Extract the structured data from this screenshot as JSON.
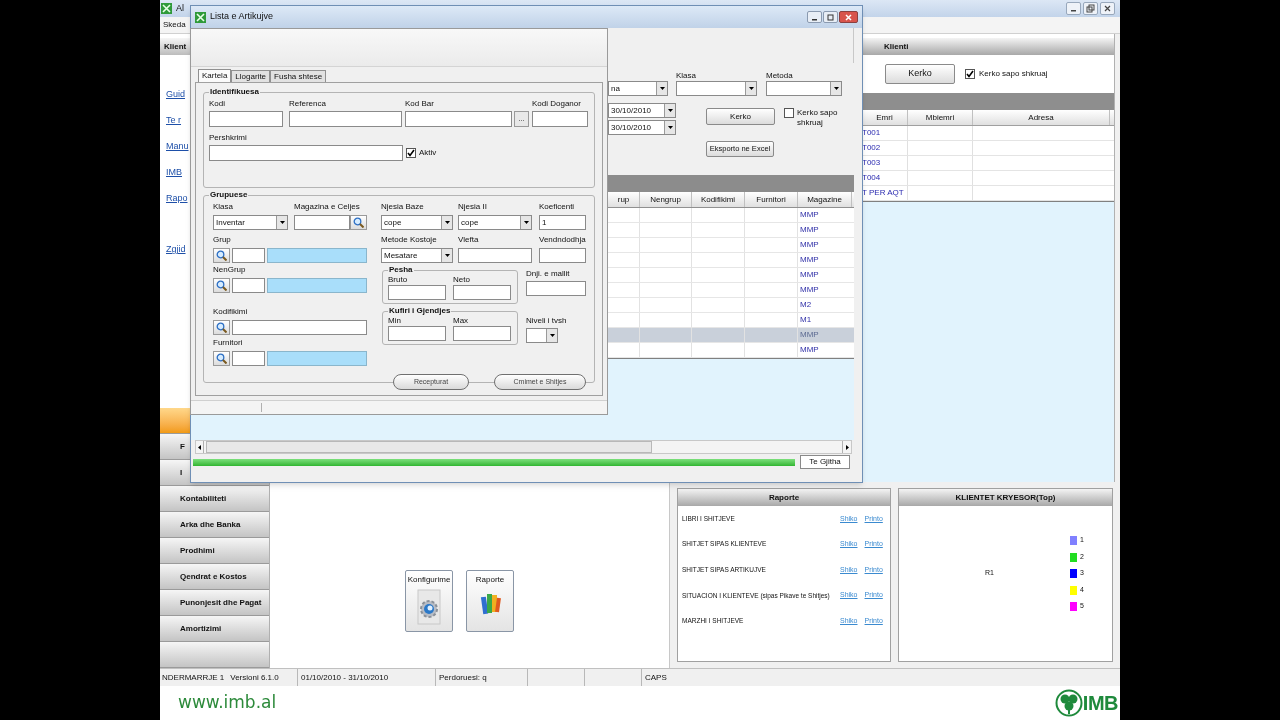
{
  "app": {
    "title": "Al",
    "menu": [
      "Skeda"
    ]
  },
  "sidebar": {
    "header": "Klient",
    "links": [
      "Guid",
      "Te r",
      "Manu",
      "IMB",
      "Rapo"
    ],
    "action": "Zgjid",
    "nav": [
      {
        "selected": true
      },
      {
        "label": "F",
        "selected": false
      },
      {
        "label": "I",
        "selected": false
      },
      {
        "label": "Kontabiliteti",
        "selected": false
      },
      {
        "label": "Arka dhe Banka",
        "selected": false
      },
      {
        "label": "Prodhimi",
        "selected": false
      },
      {
        "label": "Qendrat e Kostos",
        "selected": false
      },
      {
        "label": "Punonjesit dhe Pagat",
        "selected": false
      },
      {
        "label": "Amortizimi",
        "selected": false
      },
      {
        "selected": false
      }
    ]
  },
  "tiles": [
    {
      "label": "Konfigurime",
      "kind": "gear"
    },
    {
      "label": "Raporte",
      "kind": "books"
    }
  ],
  "klienti": {
    "title": "Klienti",
    "search_button": "Kerko",
    "live_search": {
      "label": "Kerko sapo shkruaj",
      "checked": true
    },
    "columns": [
      "Emri",
      "Mbiemri",
      "Adresa"
    ],
    "rows": [
      "T001",
      "T002",
      "T003",
      "T004",
      "T PER AQT"
    ]
  },
  "reports": {
    "title": "Raporte",
    "items": [
      {
        "name": "LIBRI I SHITJEVE",
        "view": "Shiko",
        "print": "Printo"
      },
      {
        "name": "SHITJET SIPAS KLIENTEVE",
        "view": "Shiko",
        "print": "Printo"
      },
      {
        "name": "SHITJET SIPAS ARTIKUJVE",
        "view": "Shiko",
        "print": "Printo"
      },
      {
        "name": "SITUACION I KLIENTEVE (sipas Pikave te Shitjes)",
        "view": "Shiko",
        "print": "Printo"
      },
      {
        "name": "MARZHI I SHITJEVE",
        "view": "Shiko",
        "print": "Printo"
      }
    ]
  },
  "top_clients": {
    "title": "KLIENTET KRYESOR(Top)",
    "series_label": "R1",
    "legend": [
      {
        "label": "1",
        "color": "#8080ff"
      },
      {
        "label": "2",
        "color": "#22dd22"
      },
      {
        "label": "3",
        "color": "#0000ff"
      },
      {
        "label": "4",
        "color": "#ffff00"
      },
      {
        "label": "5",
        "color": "#ff00ff"
      }
    ]
  },
  "status_bar": {
    "company": "NDERMARRJE 1",
    "version": "Versioni 6.1.0",
    "period": "01/10/2010 - 31/10/2010",
    "user": "Perdoruesi: q",
    "caps": "CAPS"
  },
  "footer": {
    "url": "www.imb.al",
    "brand": "IMB"
  },
  "list_window": {
    "title": "Lista e Artikujve",
    "combo_value": "na",
    "filter_labels": [
      "Klasa",
      "Metoda"
    ],
    "dates": [
      "30/10/2010",
      "30/10/2010"
    ],
    "search_button": "Kerko",
    "live_search": {
      "label": "Kerko sapo shkruaj",
      "checked": false
    },
    "export_button": "Eksporto ne Excel",
    "columns": [
      "rup",
      "Nengrup",
      "Kodifikimi",
      "Furnitori",
      "Magazine"
    ],
    "rows": [
      {
        "magazine": "MMP",
        "selected": false
      },
      {
        "magazine": "MMP",
        "selected": false
      },
      {
        "magazine": "MMP",
        "selected": false
      },
      {
        "magazine": "MMP",
        "selected": false
      },
      {
        "magazine": "MMP",
        "selected": false
      },
      {
        "magazine": "MMP",
        "selected": false
      },
      {
        "magazine": "M2",
        "selected": false
      },
      {
        "magazine": "M1",
        "selected": false
      },
      {
        "magazine": "MMP",
        "selected": true
      },
      {
        "magazine": "MMP",
        "selected": false
      }
    ],
    "all_button": "Te Gjitha",
    "progress": {
      "level": 1
    }
  },
  "item_form": {
    "tabs": [
      {
        "label": "Kartela",
        "selected": true
      },
      {
        "label": "Llogarite",
        "selected": false
      },
      {
        "label": "Fusha shtese",
        "selected": false
      }
    ],
    "identification": {
      "title": "Identifikuesa",
      "code": "Kodi",
      "reference": "Referenca",
      "barcode": "Kod Bar",
      "browse_button": "...",
      "customs_code": "Kodi Doganor",
      "description": "Pershkrimi",
      "active": {
        "label": "Aktiv",
        "checked": true
      }
    },
    "grouping": {
      "title": "Grupuese",
      "klasa": {
        "label": "Klasa",
        "value": "Inventar"
      },
      "magazina": {
        "label": "Magazina e Celjes"
      },
      "njesia_baze": {
        "label": "Njesia Baze",
        "value": "cope"
      },
      "njesia_ii": {
        "label": "Njesia II",
        "value": "cope"
      },
      "koeficenti": {
        "label": "Koeficenti",
        "value": "1"
      },
      "grup": {
        "label": "Grup"
      },
      "metoda": {
        "label": "Metode Kostoje",
        "value": "Mesatare"
      },
      "vlefta": {
        "label": "Vlefta"
      },
      "vendndodhja": {
        "label": "Vendndodhja"
      },
      "nengrup": {
        "label": "NenGrup"
      },
      "pesha": {
        "title": "Pesha",
        "bruto": "Bruto",
        "neto": "Neto"
      },
      "dnji": {
        "label": "Dnji. e mallit"
      },
      "kodifikimi": {
        "label": "Kodifikimi"
      },
      "furnitori": {
        "label": "Furnitori"
      },
      "kufiri": {
        "title": "Kufiri i Gjendjes",
        "min": "Min",
        "max": "Max"
      },
      "niveli": {
        "label": "Niveli i tvsh"
      }
    },
    "buttons": [
      "Recepturat",
      "Cmimet e Shitjes"
    ]
  }
}
